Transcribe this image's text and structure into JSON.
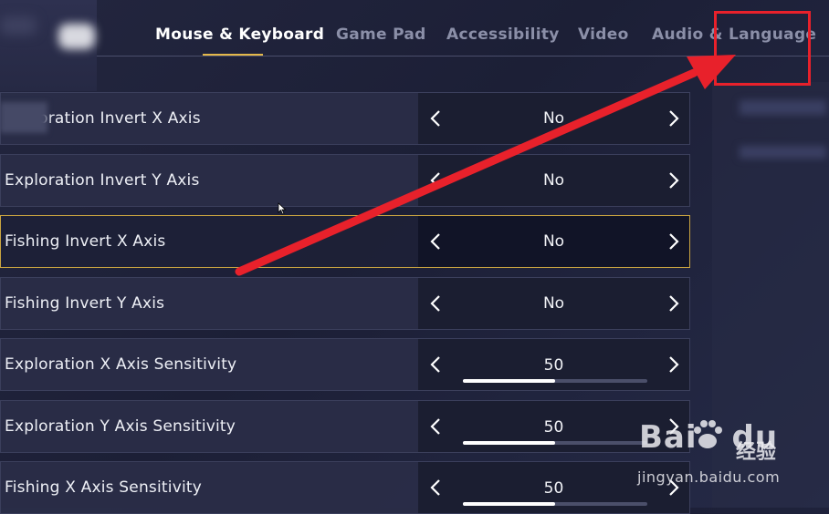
{
  "tabs": [
    {
      "label": "Mouse & Keyboard",
      "active": true
    },
    {
      "label": "Game Pad",
      "active": false
    },
    {
      "label": "Accessibility",
      "active": false
    },
    {
      "label": "Video",
      "active": false
    },
    {
      "label": "Audio & Language",
      "active": false
    }
  ],
  "settings": [
    {
      "label": "Exploration Invert X Axis",
      "value": "No"
    },
    {
      "label": "Exploration Invert Y Axis",
      "value": "No"
    },
    {
      "label": "Fishing Invert X Axis",
      "value": "No"
    },
    {
      "label": "Fishing Invert Y Axis",
      "value": "No"
    },
    {
      "label": "Exploration X Axis Sensitivity",
      "value": "50",
      "slider_fraction": 0.5
    },
    {
      "label": "Exploration Y Axis Sensitivity",
      "value": "50",
      "slider_fraction": 0.5
    },
    {
      "label": "Fishing X Axis Sensitivity",
      "value": "50",
      "slider_fraction": 0.5
    }
  ],
  "watermark": {
    "logo": "Bai",
    "logo_suffix": "du",
    "chinese": "经验",
    "url": "jingyan.baidu.com"
  },
  "colors": {
    "accent": "#e4b84a",
    "annotation": "#e8212b"
  }
}
